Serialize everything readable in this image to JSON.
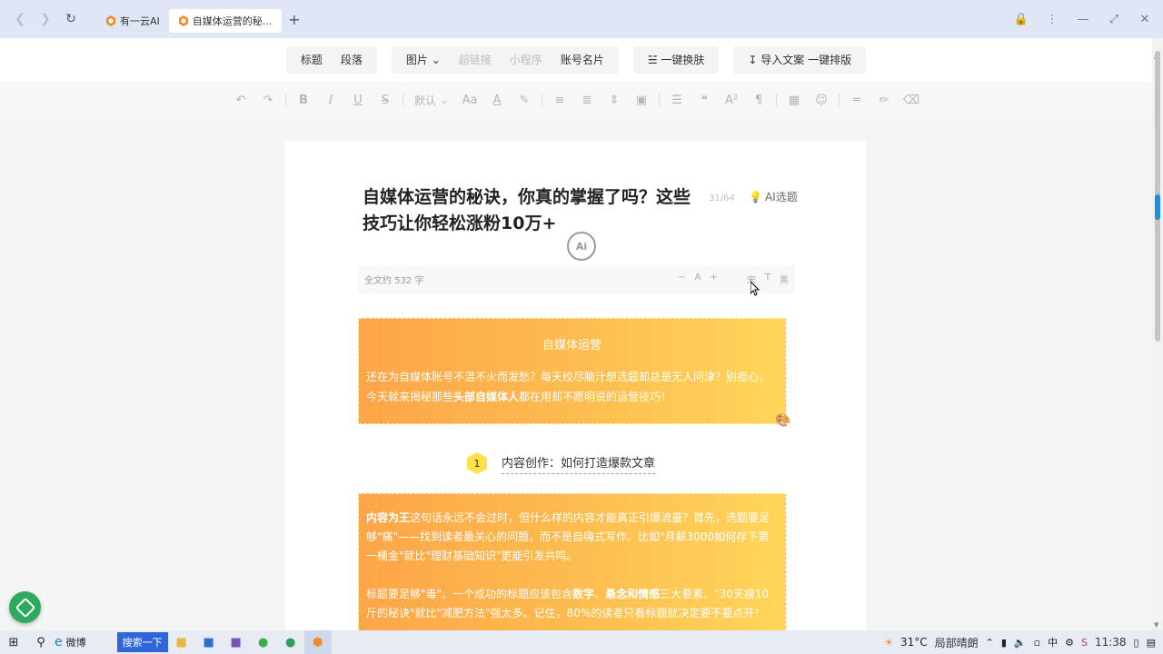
{
  "browser": {
    "tabs": [
      {
        "label": "有一云AI",
        "active": false
      },
      {
        "label": "自媒体运营的秘...",
        "active": true
      }
    ],
    "new_tab": "+"
  },
  "topbar": {
    "group1": [
      "标题",
      "段落"
    ],
    "group2": [
      {
        "label": "图片 ⌄",
        "disabled": false
      },
      {
        "label": "超链接",
        "disabled": true
      },
      {
        "label": "小程序",
        "disabled": true
      },
      {
        "label": "账号名片",
        "disabled": false
      }
    ],
    "skin": "一键换肤",
    "import": "导入文案 一键排版"
  },
  "formatbar": {
    "font_default": "默认"
  },
  "document": {
    "title": "自媒体运营的秘诀，你真的掌握了吗？这些技巧让你轻松涨粉10万+",
    "title_count": "31/64",
    "ai_topic": "AI选题",
    "ai_badge": "Ai",
    "stats_text": "全文约 532 字",
    "stats_controls": [
      "−",
      "A",
      "+",
      "宋",
      "T",
      "黑"
    ],
    "card1": {
      "heading": "自媒体运营",
      "body_pre": "还在为自媒体账号不温不火而发愁？每天绞尽脑汁想选题却总是无人问津？别担心，今天就来揭秘那些",
      "body_bold": "头部自媒体人",
      "body_post": "都在用却不愿明说的运营技巧！"
    },
    "section1": {
      "num": "1",
      "title": "内容创作：如何打造爆款文章"
    },
    "card2": {
      "p1_bold": "内容为王",
      "p1_rest": "这句话永远不会过时，但什么样的内容才能真正引爆流量？首先，选题要足够\"痛\"——找到读者最关心的问题，而不是自嗨式写作。比如\"月薪3000如何存下第一桶金\"就比\"理财基础知识\"更能引发共鸣。",
      "p2_pre": "标题要足够\"毒\"。一个成功的标题应该包含",
      "p2_bold1": "数字",
      "p2_sep": "、",
      "p2_bold2": "悬念和情感",
      "p2_post": "三大要素。\"30天瘦10斤的秘诀\"就比\"减肥方法\"强太多。记住，80%的读者只看标题就决定要不要点开！"
    }
  },
  "taskbar": {
    "weibo": "微博",
    "search": "搜索一下",
    "temperature": "31°C",
    "weather": "局部晴朗",
    "time": "11:38"
  },
  "colors": {
    "card_gradient_start": "#fda548",
    "card_gradient_end": "#ffd65a",
    "badge_yellow": "#ffe046",
    "chrome_bg": "#dfe7f6",
    "float_green": "#2eaa5f"
  }
}
